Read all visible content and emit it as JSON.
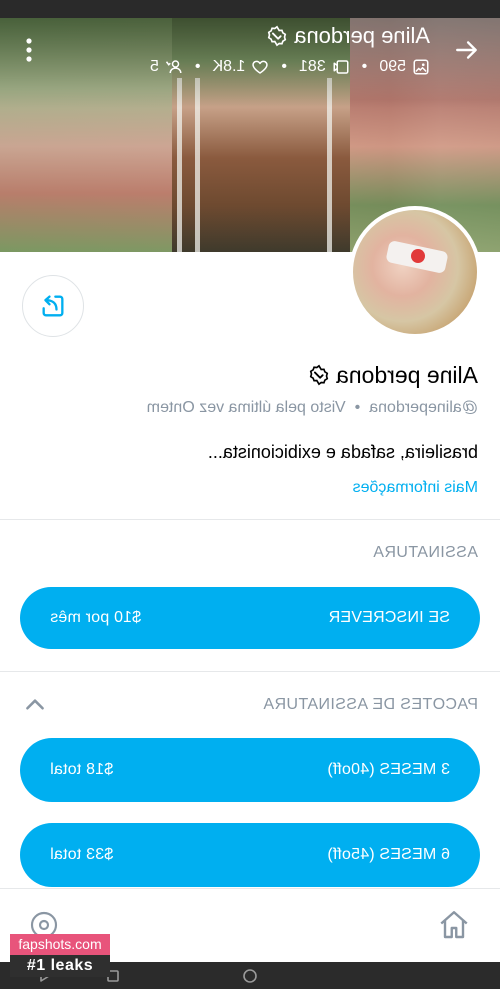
{
  "header": {
    "title": "Aline perdona",
    "stats": {
      "photos": "590",
      "videos": "381",
      "likes": "1.8K",
      "fans": "5"
    },
    "separator": "•"
  },
  "profile": {
    "name": "Aline perdona",
    "handle": "@alineperdona",
    "separator": "•",
    "last_seen": "Visto pela última vez Ontem",
    "bio": "brasileira, safada e exibicionista...",
    "more_info": "Mais informações"
  },
  "subscription": {
    "heading": "ASSINATURA",
    "button": {
      "label": "SE INSCREVER",
      "price": "$10 por mês"
    }
  },
  "bundles": {
    "heading": "PACOTES DE ASSINATURA",
    "items": [
      {
        "label": "3 MESES (40off)",
        "price": "$18 total"
      },
      {
        "label": "6 MESES (45off)",
        "price": "$33 total"
      }
    ]
  },
  "watermark": {
    "site": "fapshots.com",
    "tag": "#1 leaks"
  },
  "colors": {
    "accent": "#00AFF0",
    "muted": "#8A96A3",
    "divider": "#E6E8EA"
  },
  "icons": [
    "back-arrow-icon",
    "verified-badge-icon",
    "photo-icon",
    "video-icon",
    "heart-icon",
    "user-icon",
    "more-vertical-icon",
    "share-icon",
    "chevron-up-icon",
    "home-icon",
    "explore-icon"
  ]
}
